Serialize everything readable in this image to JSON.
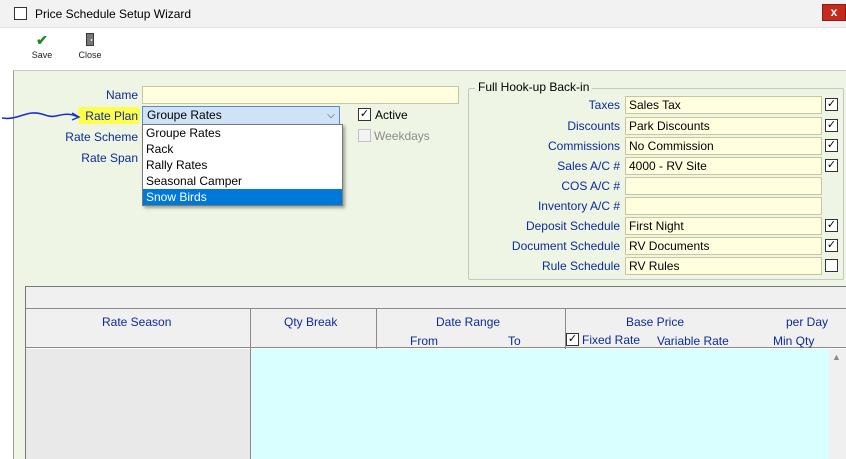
{
  "window": {
    "title": "Price Schedule Setup Wizard",
    "close_glyph": "x"
  },
  "toolbar": {
    "save_label": "Save",
    "close_label": "Close"
  },
  "form": {
    "name_label": "Name",
    "name_value": "",
    "rate_plan_label": "Rate Plan",
    "rate_plan_value": "Groupe Rates",
    "rate_plan_options": [
      "Groupe Rates",
      "Rack",
      "Rally Rates",
      "Seasonal Camper",
      "Snow Birds"
    ],
    "rate_plan_highlighted_option": "Snow Birds",
    "rate_scheme_label": "Rate Scheme",
    "rate_span_label": "Rate Span",
    "active_label": "Active",
    "active_checked": true,
    "weekdays_label": "Weekdays",
    "weekdays_checked": false
  },
  "hookup": {
    "legend": "Full Hook-up Back-in",
    "rows": [
      {
        "label": "Taxes",
        "value": "Sales Tax",
        "checked": true
      },
      {
        "label": "Discounts",
        "value": "Park Discounts",
        "checked": true
      },
      {
        "label": "Commissions",
        "value": "No Commission",
        "checked": true
      },
      {
        "label": "Sales A/C #",
        "value": "4000 - RV Site",
        "checked": true
      },
      {
        "label": "COS A/C #",
        "value": ""
      },
      {
        "label": "Inventory A/C #",
        "value": ""
      },
      {
        "label": "Deposit Schedule",
        "value": "First Night",
        "checked": true
      },
      {
        "label": "Document Schedule",
        "value": "RV Documents",
        "checked": true
      },
      {
        "label": "Rule Schedule",
        "value": "RV Rules",
        "checked": false
      }
    ]
  },
  "grid": {
    "rate_season": "Rate Season",
    "qty_break": "Qty Break",
    "date_range": "Date Range",
    "from": "From",
    "to": "To",
    "base_price": "Base Price",
    "fixed_rate": "Fixed Rate",
    "fixed_rate_checked": true,
    "variable_rate": "Variable Rate",
    "per_day": "per Day",
    "min_qty": "Min Qty"
  },
  "icons": {
    "save": "green-checkmark-icon",
    "close": "door-icon",
    "accent_blue": "#0b2b9a",
    "field_yellow": "#ffffe0",
    "panel_green": "#eef5e4",
    "grid_cyan": "#d9fffe",
    "select_blue": "#0078d7",
    "annotation_yellow": "#ffff3b",
    "annotation_pen": "#1b2fcf"
  }
}
